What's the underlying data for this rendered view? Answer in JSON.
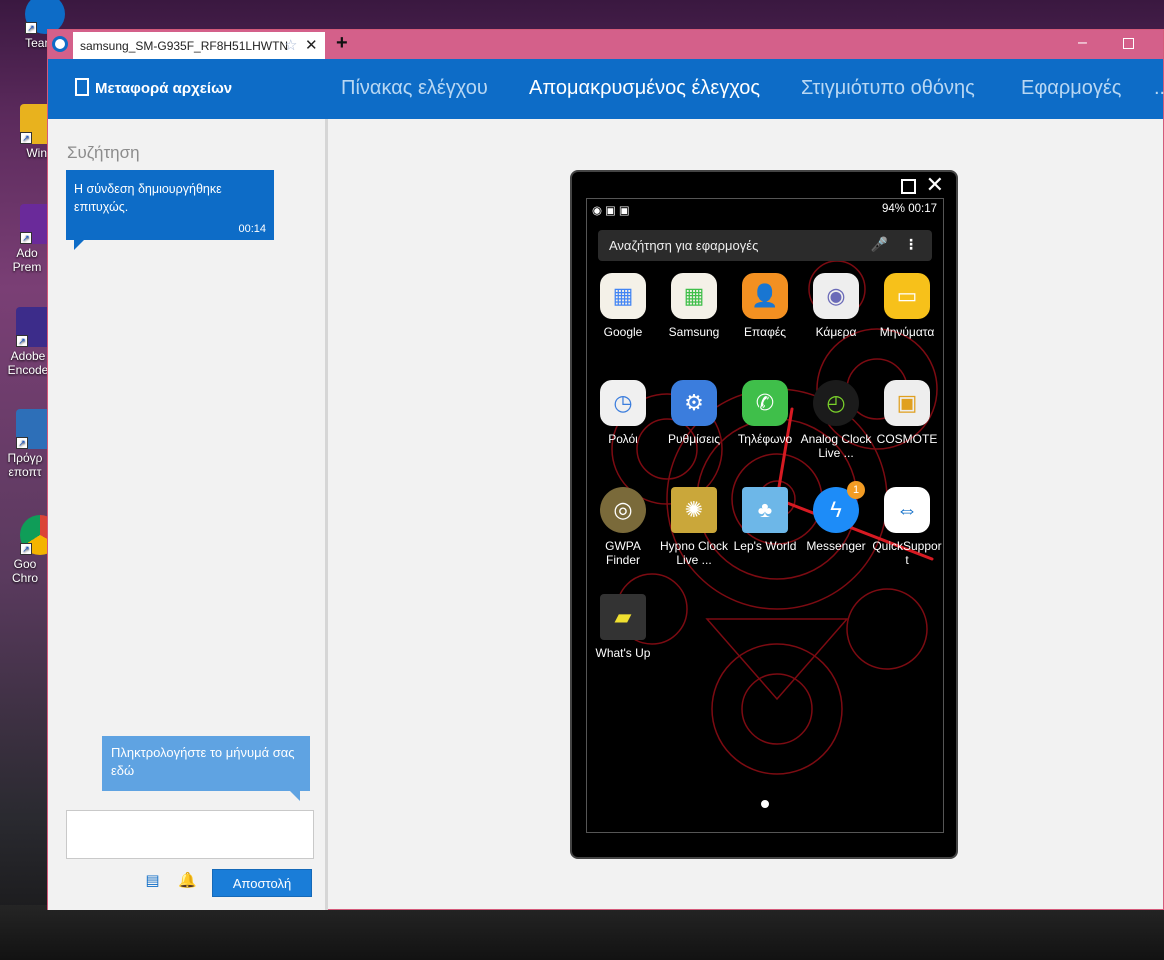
{
  "desktop": {
    "icons": [
      {
        "label": "TeamVi",
        "icon": "teamviewer-icon",
        "color": "#0d6cc7"
      },
      {
        "label": "Wina",
        "icon": "winamp-icon",
        "color": "#e8b21e"
      },
      {
        "label": "Ado Prem",
        "icon": "adobe-premiere-icon",
        "color": "#6a2a9a"
      },
      {
        "label": "Adobe Encode",
        "icon": "adobe-encoder-icon",
        "color": "#3c2c8a"
      },
      {
        "label": "Πρόγρ εποπτ",
        "icon": "monitor-program-icon",
        "color": "#2d6fb8"
      },
      {
        "label": "Goo Chro",
        "icon": "chrome-icon",
        "color": "#2ea044"
      }
    ]
  },
  "window": {
    "tab_title": "samsung_SM-G935F_RF8H51LHWTN",
    "new_tab": "+",
    "minimize": "–"
  },
  "nav": {
    "file_transfer": "Μεταφορά αρχείων",
    "items": [
      {
        "label": "Πίνακας ελέγχου",
        "active": false
      },
      {
        "label": "Απομακρυσμένος έλεγχος",
        "active": true
      },
      {
        "label": "Στιγμιότυπο οθόνης",
        "active": false
      },
      {
        "label": "Εφαρμογές",
        "active": false
      },
      {
        "label": "...",
        "active": false
      }
    ]
  },
  "chat": {
    "title": "Συζήτηση",
    "message": {
      "text": "Η σύνδεση δημιουργήθηκε επιτυχώς.",
      "time": "00:14"
    },
    "input_hint": "Πληκτρολογήστε το μήνυμά σας εδώ",
    "send_label": "Αποστολή"
  },
  "phone": {
    "status_right": "94% 00:17",
    "battery": "94%",
    "time": "00:17",
    "search_placeholder": "Αναζήτηση για εφαρμογές",
    "apps": [
      {
        "label": "Google",
        "icon": "google-folder-icon",
        "bg": "#f4f1e8"
      },
      {
        "label": "Samsung",
        "icon": "samsung-folder-icon",
        "bg": "#f4f1e8"
      },
      {
        "label": "Επαφές",
        "icon": "contacts-icon",
        "bg": "#f39021"
      },
      {
        "label": "Κάμερα",
        "icon": "camera-icon",
        "bg": "#eeeeee"
      },
      {
        "label": "Μηνύματα",
        "icon": "messages-icon",
        "bg": "#f7c11a"
      },
      {
        "label": "Ρολόι",
        "icon": "clock-icon",
        "bg": "#f0f0f0"
      },
      {
        "label": "Ρυθμίσεις",
        "icon": "settings-icon",
        "bg": "#3b7ddd"
      },
      {
        "label": "Τηλέφωνο",
        "icon": "phone-icon",
        "bg": "#3fbf4a"
      },
      {
        "label": "Analog Clock Live ...",
        "icon": "analog-clock-icon",
        "bg": "#1b1b1b"
      },
      {
        "label": "COSMOTE",
        "icon": "sim-card-icon",
        "bg": "#eeeeee"
      },
      {
        "label": "GWPA Finder",
        "icon": "gwpa-finder-icon",
        "bg": "#7a6a3a"
      },
      {
        "label": "Hypno Clock Live ...",
        "icon": "hypno-clock-icon",
        "bg": "#caa73a"
      },
      {
        "label": "Lep's World",
        "icon": "leps-world-icon",
        "bg": "#6db7e8"
      },
      {
        "label": "Messenger",
        "icon": "messenger-icon",
        "bg": "#1d8cf8",
        "badge": "1"
      },
      {
        "label": "QuickSupport",
        "icon": "quicksupport-icon",
        "bg": "#ffffff"
      },
      {
        "label": "What's Up",
        "icon": "whatsup-icon",
        "bg": "#333333"
      }
    ]
  }
}
